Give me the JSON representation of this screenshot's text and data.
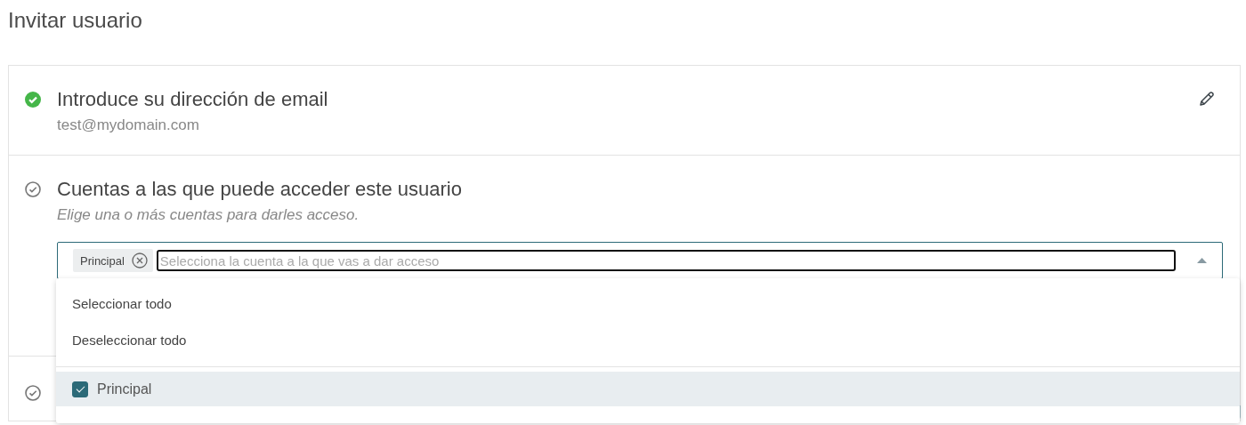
{
  "title": "Invitar usuario",
  "steps": [
    {
      "kind": "value",
      "completed": true,
      "title": "Introduce su dirección de email",
      "value": "test@mydomain.com",
      "editable": true
    },
    {
      "kind": "multiselect",
      "completed": false,
      "title": "Cuentas a las que puede acceder este usuario",
      "hint": "Elige una o más cuentas para darles acceso.",
      "multiselect": {
        "chips": [
          {
            "label": "Principal"
          }
        ],
        "placeholder": "Selecciona la cuenta a la que vas a dar acceso",
        "expanded": true,
        "actions": [
          "Seleccionar todo",
          "Deseleccionar todo"
        ],
        "options": [
          {
            "label": "Principal",
            "checked": true,
            "highlighted": true
          }
        ]
      }
    },
    {
      "kind": "collapsed",
      "completed": false
    }
  ]
}
